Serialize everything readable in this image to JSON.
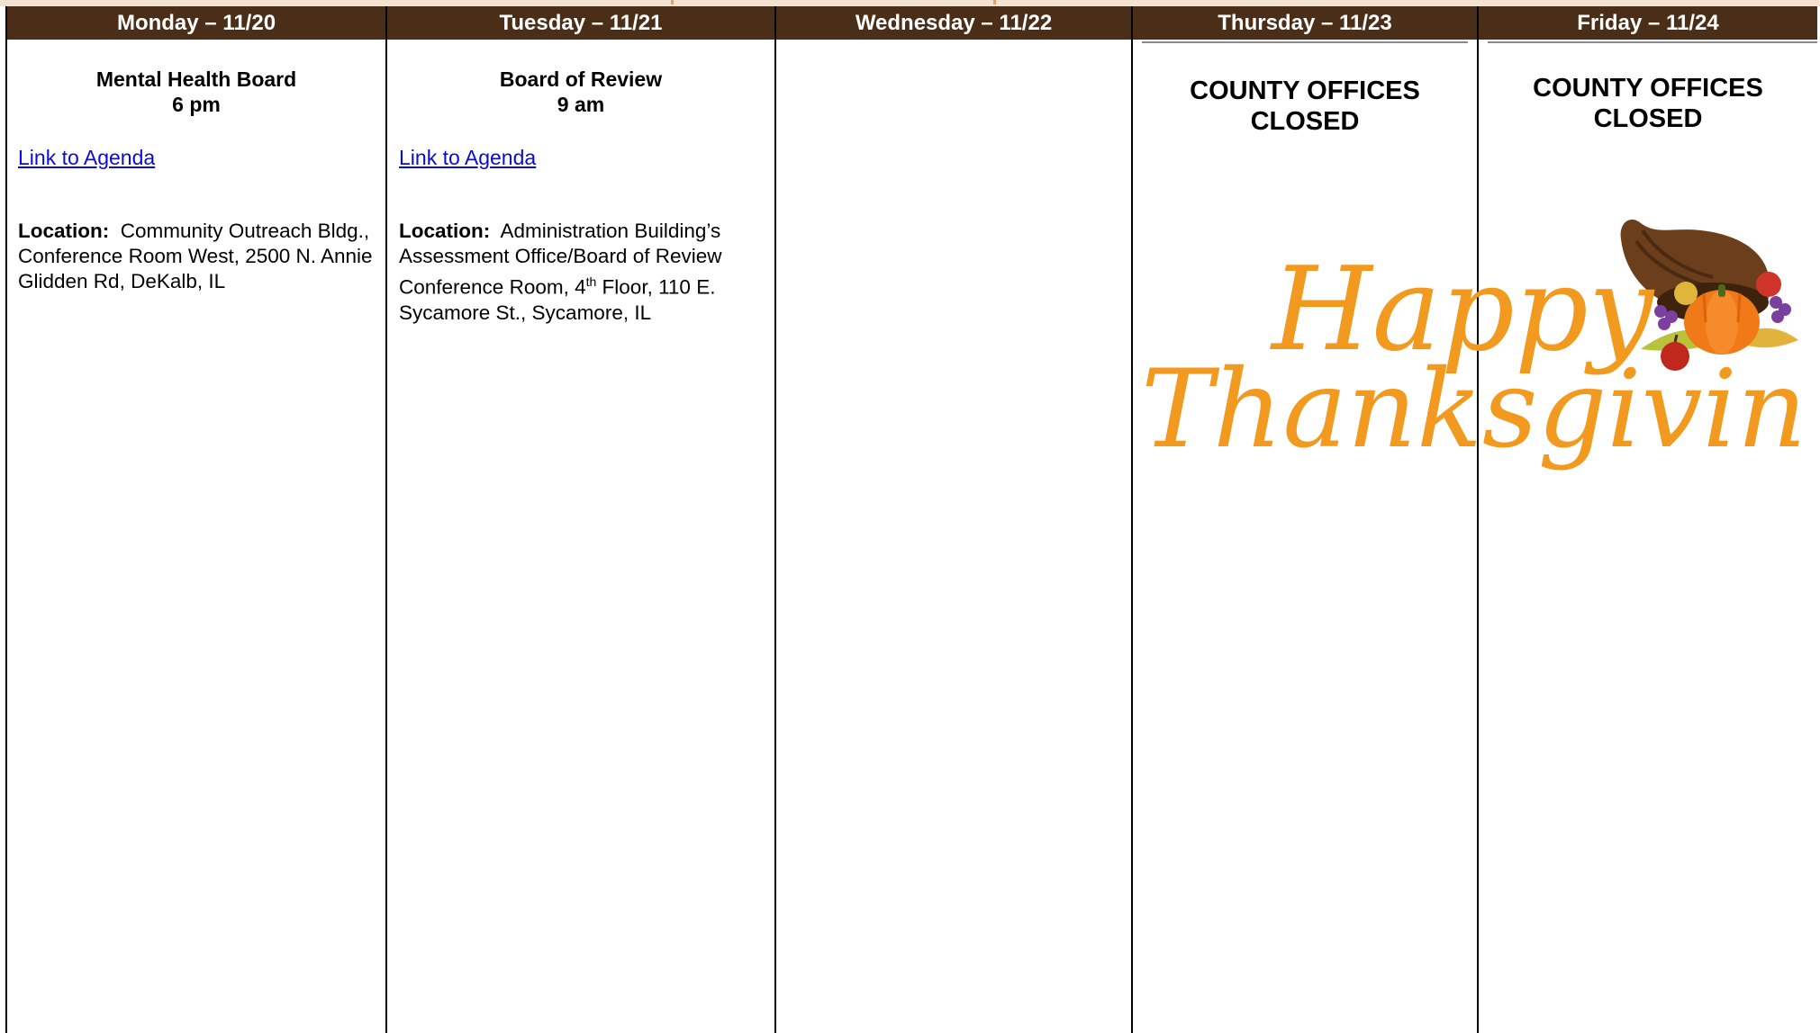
{
  "days": [
    {
      "header": "Monday – 11/20"
    },
    {
      "header": "Tuesday – 11/21"
    },
    {
      "header": "Wednesday – 11/22"
    },
    {
      "header": "Thursday – 11/23"
    },
    {
      "header": "Friday – 11/24"
    }
  ],
  "monday": {
    "title": "Mental Health Board",
    "time": "6 pm",
    "link": "Link to Agenda",
    "location_label": "Location:",
    "location_text": "Community Outreach Bldg., Conference Room West, 2500 N. Annie Glidden Rd, DeKalb, IL"
  },
  "tuesday": {
    "title": "Board of Review",
    "time": "9 am",
    "link": "Link to Agenda",
    "location_label": "Location:",
    "location_pre": "Administration Building’s Assessment Office/Board of Review Conference Room, 4",
    "location_sup": "th",
    "location_post": " Floor, 110 E. Sycamore St., Sycamore, IL"
  },
  "thursday": {
    "closed_line1": "COUNTY OFFICES",
    "closed_line2": "CLOSED"
  },
  "friday": {
    "closed_line1": "COUNTY OFFICES",
    "closed_line2": "CLOSED"
  },
  "art": {
    "line1": "Happy",
    "line2": "Thanksgiving",
    "color": "#f29a1f"
  },
  "colors": {
    "header_bg": "#4a2e17",
    "link": "#0b0bd6"
  }
}
